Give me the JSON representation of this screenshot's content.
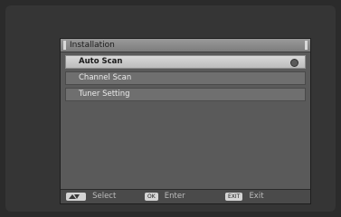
{
  "panel": {
    "title": "Installation",
    "menu_items": [
      {
        "label": "Auto Scan",
        "selected": true
      },
      {
        "label": "Channel Scan",
        "selected": false
      },
      {
        "label": "Tuner Setting",
        "selected": false
      }
    ]
  },
  "footer": {
    "select": {
      "key_icon": "up-down-arrows-icon",
      "label": "Select"
    },
    "enter": {
      "key": "OK",
      "label": "Enter"
    },
    "exit": {
      "key": "EXIT",
      "label": "Exit"
    }
  },
  "colors": {
    "background": "#2b2b2b",
    "panel": "#5a5a5a",
    "selected_row": "#cfcfcf",
    "row": "#6f6f6f"
  }
}
